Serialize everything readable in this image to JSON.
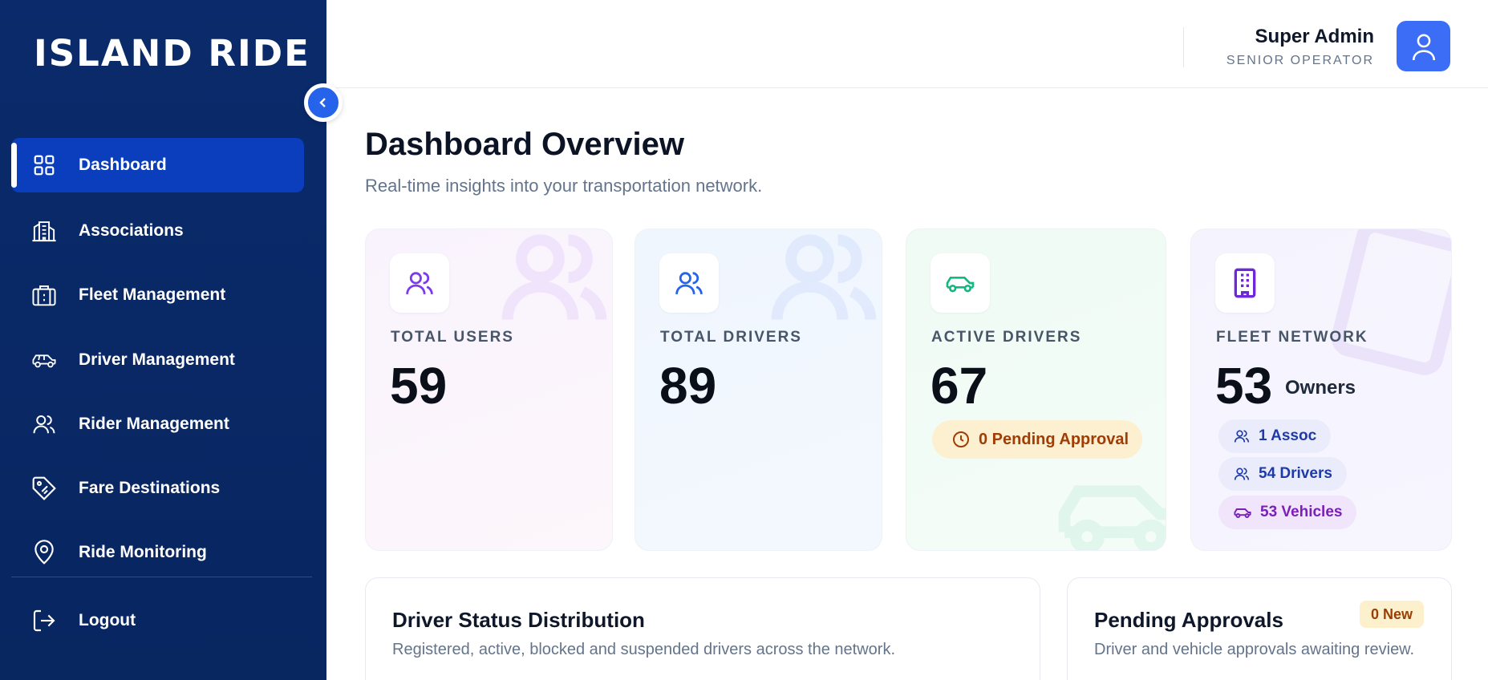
{
  "app": {
    "logo_text": "ISLAND RIDE"
  },
  "sidebar": {
    "items": [
      {
        "label": "Dashboard",
        "icon": "grid-icon",
        "active": true
      },
      {
        "label": "Associations",
        "icon": "building-icon"
      },
      {
        "label": "Fleet Management",
        "icon": "briefcase-icon"
      },
      {
        "label": "Driver Management",
        "icon": "car-icon"
      },
      {
        "label": "Rider Management",
        "icon": "users-icon"
      },
      {
        "label": "Fare Destinations",
        "icon": "tag-icon"
      },
      {
        "label": "Ride Monitoring",
        "icon": "map-pin-icon"
      }
    ],
    "logout_label": "Logout"
  },
  "header": {
    "user_name": "Super Admin",
    "user_role": "SENIOR OPERATOR"
  },
  "main": {
    "title": "Dashboard Overview",
    "subtitle": "Real-time insights into your transportation network.",
    "stats": {
      "total_users": {
        "label": "TOTAL USERS",
        "value": "59"
      },
      "total_drivers": {
        "label": "TOTAL DRIVERS",
        "value": "89"
      },
      "active_drivers": {
        "label": "ACTIVE DRIVERS",
        "value": "67",
        "pending": "0 Pending Approval"
      },
      "fleet_network": {
        "label": "FLEET NETWORK",
        "value": "53",
        "unit": "Owners",
        "assoc": "1 Assoc",
        "drivers": "54 Drivers",
        "vehicles": "53 Vehicles"
      }
    },
    "panels": {
      "distribution": {
        "title": "Driver Status Distribution",
        "subtitle": "Registered, active, blocked and suspended drivers across the network."
      },
      "approvals": {
        "title": "Pending Approvals",
        "subtitle": "Driver and vehicle approvals awaiting review.",
        "badge": "0 New"
      }
    }
  },
  "colors": {
    "sidebar_bg": "#0a2a6b",
    "active_nav": "#0a3ebd",
    "accent": "#2563eb",
    "purple": "#7c3aed",
    "green": "#10b981",
    "amber_bg": "#fdf0d0"
  }
}
